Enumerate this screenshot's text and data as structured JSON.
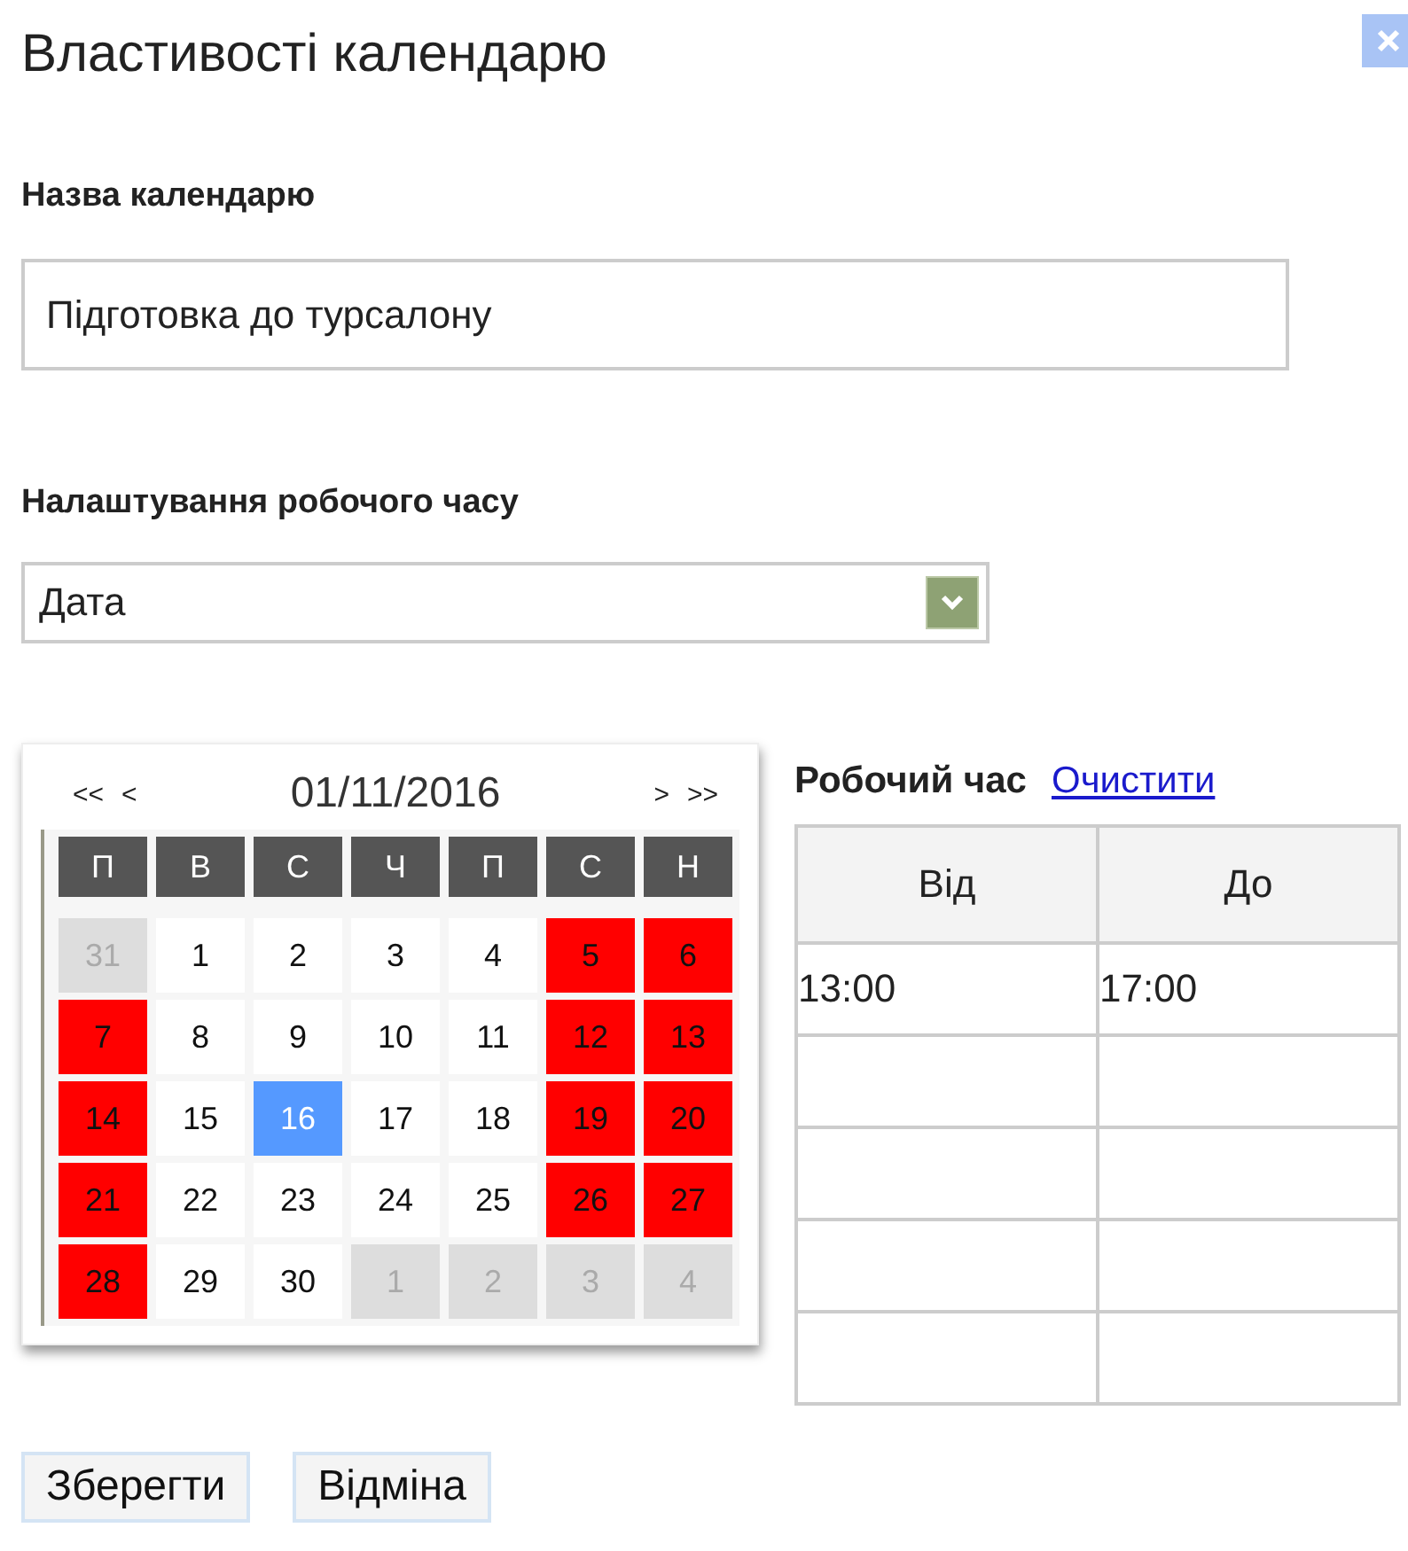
{
  "dialog": {
    "title": "Властивості календарю"
  },
  "name_field": {
    "label": "Назва календарю",
    "value": "Підготовка до турсалону"
  },
  "work_time_setting": {
    "label": "Налаштування робочого часу",
    "value": "Дата"
  },
  "calendar": {
    "nav_prev": [
      "<<",
      "<"
    ],
    "month": "01/11/2016",
    "nav_next": [
      ">",
      ">>"
    ],
    "weekdays": [
      "П",
      "В",
      "С",
      "Ч",
      "П",
      "С",
      "Н"
    ],
    "days": [
      {
        "day": "31",
        "kind": "other",
        "selected": false
      },
      {
        "day": "1",
        "kind": "work",
        "selected": false
      },
      {
        "day": "2",
        "kind": "work",
        "selected": false
      },
      {
        "day": "3",
        "kind": "work",
        "selected": false
      },
      {
        "day": "4",
        "kind": "work",
        "selected": false
      },
      {
        "day": "5",
        "kind": "holiday",
        "selected": false
      },
      {
        "day": "6",
        "kind": "holiday",
        "selected": false
      },
      {
        "day": "7",
        "kind": "holiday",
        "selected": false
      },
      {
        "day": "8",
        "kind": "work",
        "selected": false
      },
      {
        "day": "9",
        "kind": "work",
        "selected": false
      },
      {
        "day": "10",
        "kind": "work",
        "selected": false
      },
      {
        "day": "11",
        "kind": "work",
        "selected": false
      },
      {
        "day": "12",
        "kind": "holiday",
        "selected": false
      },
      {
        "day": "13",
        "kind": "holiday",
        "selected": false
      },
      {
        "day": "14",
        "kind": "holiday",
        "selected": false
      },
      {
        "day": "15",
        "kind": "work",
        "selected": false
      },
      {
        "day": "16",
        "kind": "work",
        "selected": true
      },
      {
        "day": "17",
        "kind": "work",
        "selected": false
      },
      {
        "day": "18",
        "kind": "work",
        "selected": false
      },
      {
        "day": "19",
        "kind": "holiday",
        "selected": false
      },
      {
        "day": "20",
        "kind": "holiday",
        "selected": false
      },
      {
        "day": "21",
        "kind": "holiday",
        "selected": false
      },
      {
        "day": "22",
        "kind": "work",
        "selected": false
      },
      {
        "day": "23",
        "kind": "work",
        "selected": false
      },
      {
        "day": "24",
        "kind": "work",
        "selected": false
      },
      {
        "day": "25",
        "kind": "work",
        "selected": false
      },
      {
        "day": "26",
        "kind": "holiday",
        "selected": false
      },
      {
        "day": "27",
        "kind": "holiday",
        "selected": false
      },
      {
        "day": "28",
        "kind": "holiday",
        "selected": false
      },
      {
        "day": "29",
        "kind": "work",
        "selected": false
      },
      {
        "day": "30",
        "kind": "work",
        "selected": false
      },
      {
        "day": "1",
        "kind": "other",
        "selected": false
      },
      {
        "day": "2",
        "kind": "other",
        "selected": false
      },
      {
        "day": "3",
        "kind": "other",
        "selected": false
      },
      {
        "day": "4",
        "kind": "other",
        "selected": false
      }
    ]
  },
  "work_hours": {
    "title": "Робочий час",
    "clear_link": "Очистити",
    "columns": [
      "Від",
      "До"
    ],
    "rows": [
      [
        "13:00",
        "17:00"
      ],
      [
        "",
        ""
      ],
      [
        "",
        ""
      ],
      [
        "",
        ""
      ],
      [
        "",
        ""
      ]
    ]
  },
  "buttons": [
    "Зберегти",
    "Відміна"
  ]
}
